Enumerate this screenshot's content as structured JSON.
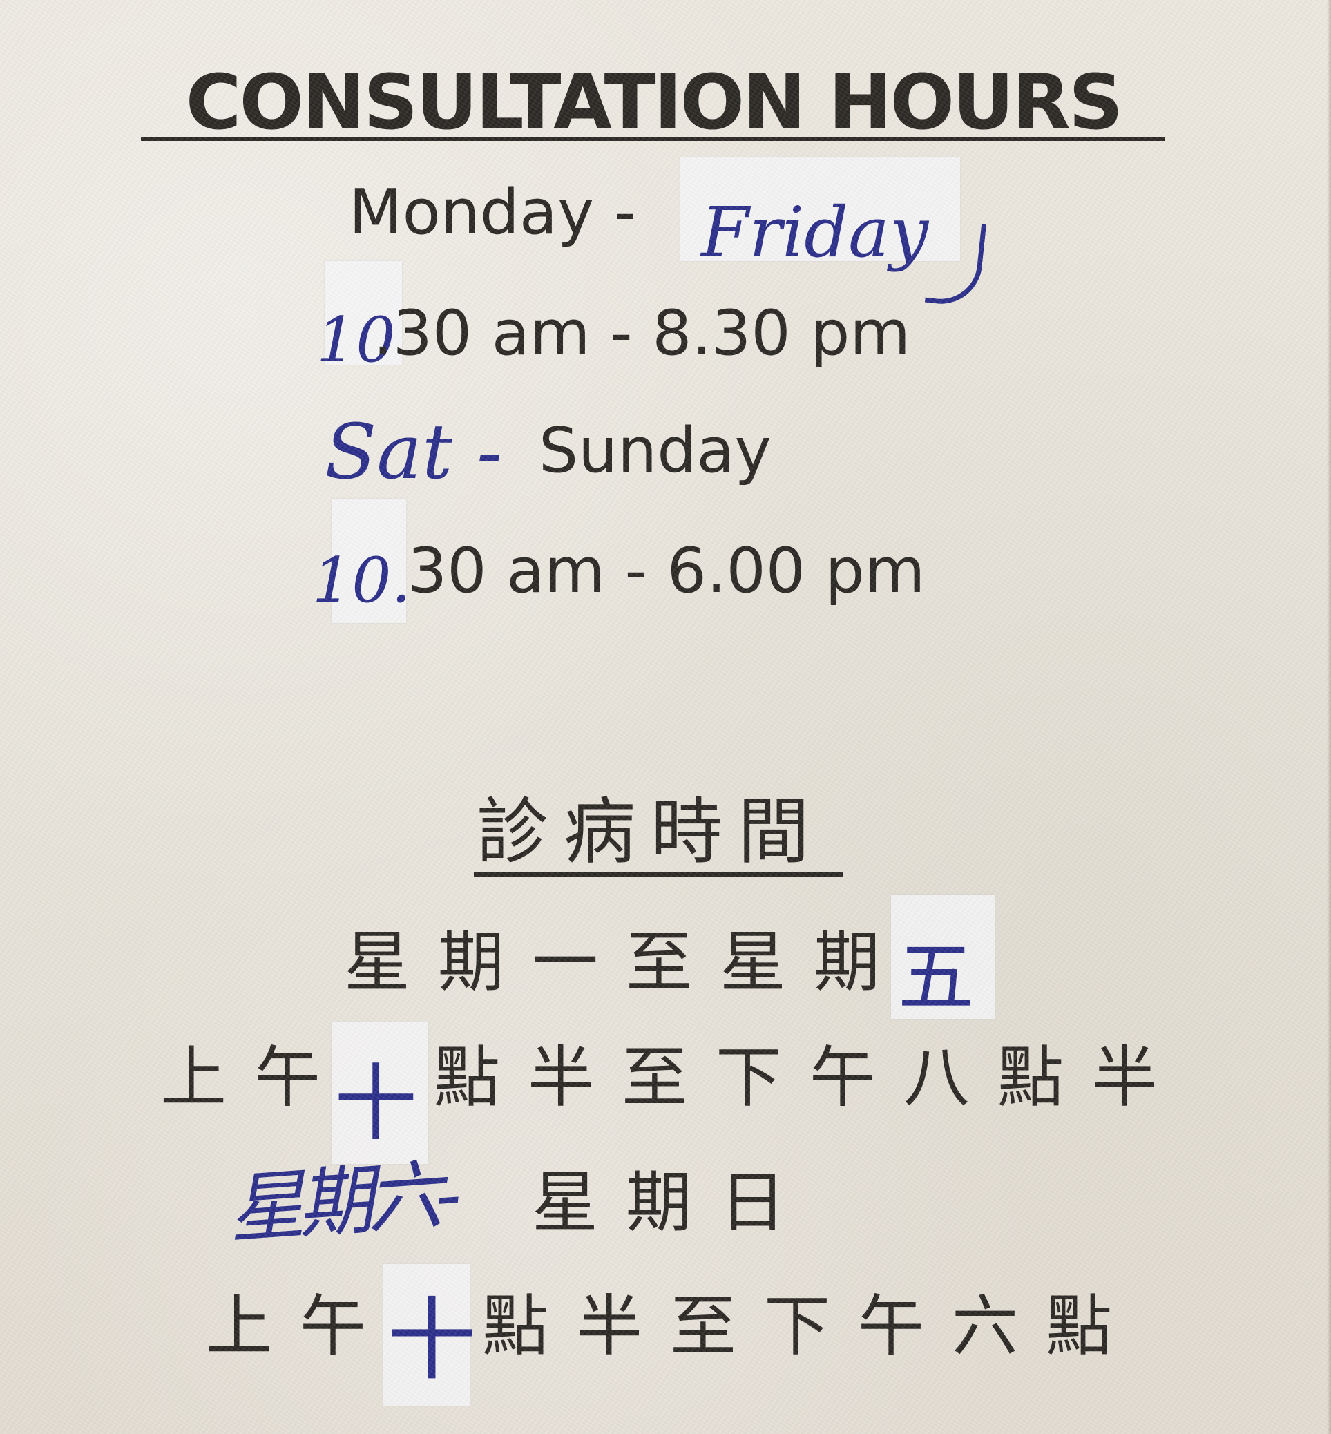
{
  "card": {
    "heading": "CONSULTATION HOURS",
    "weekday_days_printed": "Monday -",
    "weekday_days_handwritten": "Friday",
    "weekday_time_handwritten_hour": "10",
    "weekday_time_printed": ".30 am - 8.30 pm",
    "weekend_days_handwritten": "Sat -",
    "weekend_days_printed": "Sunday",
    "weekend_time_handwritten_hour": "10.",
    "weekend_time_printed": "30 am - 6.00 pm",
    "zh_heading": "診病時間",
    "zh_weekday_days_printed": "星期一至星期",
    "zh_weekday_days_handwritten": "五",
    "zh_weekday_time_prefix": "上午",
    "zh_weekday_time_handwritten": "十",
    "zh_weekday_time_suffix": "點半至下午八點半",
    "zh_weekend_days_handwritten": "星期六-",
    "zh_weekend_days_printed": "星期日",
    "zh_weekend_time_prefix": "上午",
    "zh_weekend_time_handwritten": "十",
    "zh_weekend_time_suffix": "點半至下午六點"
  },
  "colors": {
    "paper": "#e9e5dc",
    "print_ink": "#2b2824",
    "pen_ink": "#2b2e8a"
  }
}
